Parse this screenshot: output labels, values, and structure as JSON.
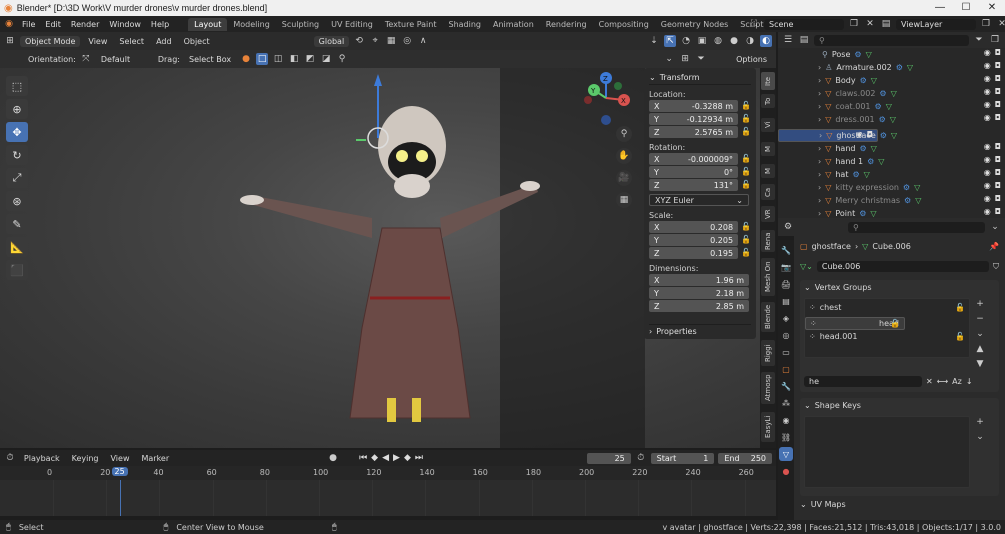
{
  "window": {
    "title": "Blender* [D:\\3D Work\\V murder drones\\v murder drones.blend]",
    "controls": [
      "—",
      "☐",
      "✕"
    ]
  },
  "topbar": {
    "menus": [
      "File",
      "Edit",
      "Render",
      "Window",
      "Help"
    ],
    "workspaces": [
      "Layout",
      "Modeling",
      "Sculpting",
      "UV Editing",
      "Texture Paint",
      "Shading",
      "Animation",
      "Rendering",
      "Compositing",
      "Geometry Nodes",
      "Scripting"
    ],
    "active_workspace": "Layout",
    "add_tab": "+",
    "scene": "Scene",
    "view_layer": "ViewLayer"
  },
  "viewport_header": {
    "mode": "Object Mode",
    "menus": [
      "View",
      "Select",
      "Add",
      "Object"
    ],
    "transform_space": "Global",
    "orientation_label": "Orientation:",
    "orientation_value": "Default",
    "drag_label": "Drag:",
    "drag_value": "Select Box",
    "options": "Options"
  },
  "gizmo": {
    "z": "Z",
    "y": "Y",
    "x": "X"
  },
  "transform": {
    "title": "Transform",
    "location_label": "Location:",
    "location": {
      "x": "-0.3288 m",
      "y": "-0.12934 m",
      "z": "2.5765 m"
    },
    "rotation_label": "Rotation:",
    "rotation": {
      "x": "-0.000009°",
      "y": "0°",
      "z": "131°"
    },
    "rotation_mode": "XYZ Euler",
    "scale_label": "Scale:",
    "scale": {
      "x": "0.208",
      "y": "0.205",
      "z": "0.195"
    },
    "dimensions_label": "Dimensions:",
    "dimensions": {
      "x": "1.96 m",
      "y": "2.18 m",
      "z": "2.85 m"
    },
    "axis": {
      "x": "X",
      "y": "Y",
      "z": "Z"
    },
    "properties": "Properties"
  },
  "sidebar_tabs": [
    "Ite",
    "To",
    "Vi",
    "M",
    "M",
    "Ca",
    "VR",
    "Rena",
    "Mesh On",
    "Blende",
    "Riggi",
    "Atmosp",
    "EasyLi"
  ],
  "outliner": {
    "items": [
      {
        "name": "Pose",
        "icon": "⚲",
        "dim": false,
        "selected": false
      },
      {
        "name": "Armature.002",
        "icon": "♙",
        "dim": false,
        "selected": false,
        "count": "9"
      },
      {
        "name": "Body",
        "icon": "▽",
        "dim": false,
        "selected": false
      },
      {
        "name": "claws.002",
        "icon": "▽",
        "dim": true,
        "selected": false
      },
      {
        "name": "coat.001",
        "icon": "▽",
        "dim": true,
        "selected": false
      },
      {
        "name": "dress.001",
        "icon": "▽",
        "dim": true,
        "selected": false
      },
      {
        "name": "ghostface",
        "icon": "▽",
        "dim": false,
        "selected": true
      },
      {
        "name": "hand",
        "icon": "▽",
        "dim": false,
        "selected": false
      },
      {
        "name": "hand 1",
        "icon": "▽",
        "dim": false,
        "selected": false
      },
      {
        "name": "hat",
        "icon": "▽",
        "dim": false,
        "selected": false
      },
      {
        "name": "kitty expression",
        "icon": "▽",
        "dim": true,
        "selected": false
      },
      {
        "name": "Merry christmas",
        "icon": "▽",
        "dim": true,
        "selected": false
      },
      {
        "name": "Point",
        "icon": "☀",
        "dim": false,
        "selected": false
      }
    ]
  },
  "properties": {
    "breadcrumb_object": "ghostface",
    "breadcrumb_data": "Cube.006",
    "mesh_name": "Cube.006",
    "vertex_groups_title": "Vertex Groups",
    "vertex_groups": [
      "chest",
      "head",
      "head.001"
    ],
    "vertex_filter": "he",
    "shape_keys_title": "Shape Keys",
    "uv_maps_title": "UV Maps"
  },
  "timeline": {
    "menus": [
      "Playback",
      "Keying",
      "View",
      "Marker"
    ],
    "current_frame": "25",
    "start_label": "Start",
    "start": "1",
    "end_label": "End",
    "end": "250",
    "ruler": [
      "0",
      "20",
      "40",
      "60",
      "80",
      "100",
      "120",
      "140",
      "160",
      "180",
      "200",
      "220",
      "240",
      "260"
    ],
    "playhead": "25"
  },
  "status": {
    "select": "Select",
    "center_view": "Center View to Mouse",
    "stats": "v avatar | ghostface | Verts:22,398 | Faces:21,512 | Tris:43,018 | Objects:1/17 | 3.0.0"
  },
  "colors": {
    "accent": "#4772b3",
    "selected_row": "#334d80",
    "orange": "#e8833a",
    "green": "#5bc96b"
  }
}
